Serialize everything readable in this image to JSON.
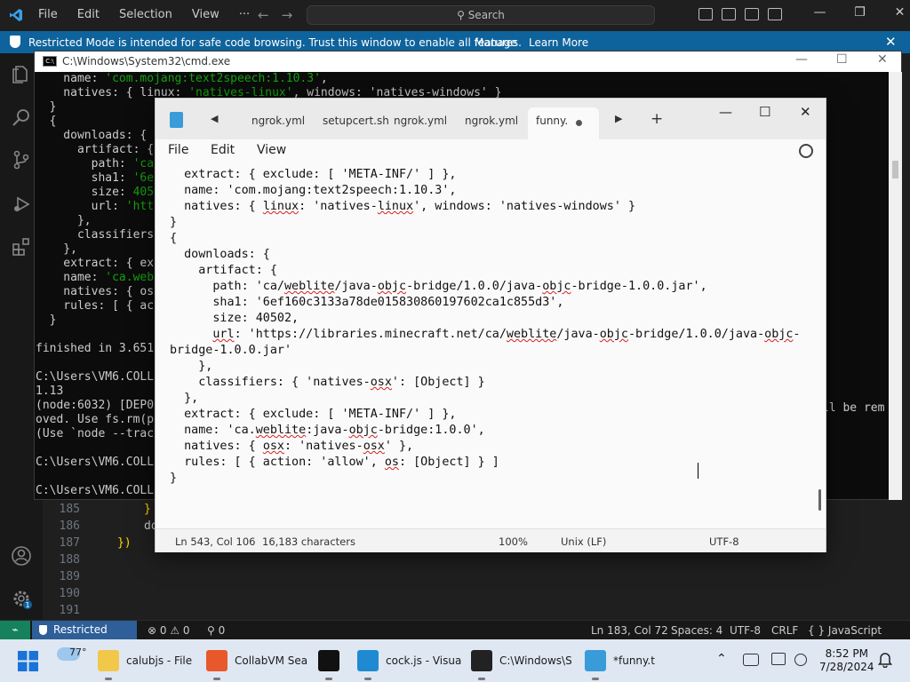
{
  "vscode": {
    "menu": [
      "File",
      "Edit",
      "Selection",
      "View",
      "···"
    ],
    "nav_back": "←",
    "nav_forward": "→",
    "search_label": "Search",
    "window_controls": [
      "—",
      "❐",
      "✕"
    ],
    "banner": {
      "message": "Restricted Mode is intended for safe code browsing. Trust this window to enable all features.",
      "manage_label": "Manage",
      "learn_more_label": "Learn More",
      "close": "✕"
    },
    "editor_lines": [
      {
        "num": "185",
        "code": "}"
      },
      {
        "num": "186",
        "code": "do"
      },
      {
        "num": "187",
        "code": "})"
      },
      {
        "num": "188",
        "code": ""
      },
      {
        "num": "189",
        "code": ""
      },
      {
        "num": "190",
        "code": ""
      },
      {
        "num": "191",
        "code": ""
      }
    ],
    "behind_text_right_1": "ll be rem",
    "behind_text_right_2": "",
    "status": {
      "remote_icon": "⌁",
      "restricted": "Restricted Mode",
      "errors": "⊗ 0 ⚠ 0",
      "ports": "⚲ 0",
      "position": "Ln 183, Col 72",
      "spaces": "Spaces: 4",
      "encoding": "UTF-8",
      "eol": "CRLF",
      "language": "{ } JavaScript",
      "accent": "#0e639c"
    }
  },
  "cmd": {
    "title": "C:\\Windows\\System32\\cmd.exe",
    "icon_text": "C:\\",
    "window_controls": [
      "—",
      "☐",
      "✕"
    ],
    "lines": [
      {
        "t": "    name: ",
        "g": "'com.mojang:text2speech:1.10.3'",
        "e": ","
      },
      {
        "t": "    natives: { linux: ",
        "g": "'natives-linux'",
        "e": ", windows: 'natives-windows' }"
      },
      {
        "t": "  }",
        "g": "",
        "e": ""
      },
      {
        "t": "  {",
        "g": "",
        "e": ""
      },
      {
        "t": "    downloads: {",
        "g": "",
        "e": ""
      },
      {
        "t": "      artifact: {",
        "g": "",
        "e": ""
      },
      {
        "t": "        path: ",
        "g": "'ca/w",
        "e": ""
      },
      {
        "t": "        sha1: ",
        "g": "'6ef1",
        "e": ""
      },
      {
        "t": "        size: ",
        "g": "40502",
        "e": ""
      },
      {
        "t": "        url: ",
        "g": "'https",
        "e": ""
      },
      {
        "t": "      },",
        "g": "",
        "e": ""
      },
      {
        "t": "      classifiers: ",
        "g": "",
        "e": ""
      },
      {
        "t": "    },",
        "g": "",
        "e": ""
      },
      {
        "t": "    extract: { excl",
        "g": "",
        "e": ""
      },
      {
        "t": "    name: ",
        "g": "'ca.webli",
        "e": ""
      },
      {
        "t": "    natives: { osx:",
        "g": "",
        "e": ""
      },
      {
        "t": "    rules: [ { acti",
        "g": "",
        "e": ""
      },
      {
        "t": "  }",
        "g": "",
        "e": ""
      },
      {
        "t": "",
        "g": "",
        "e": ""
      },
      {
        "t": "finished in 3.651",
        "g": "",
        "e": ""
      },
      {
        "t": "",
        "g": "",
        "e": ""
      },
      {
        "t": "C:\\Users\\VM6.COLL",
        "g": "",
        "e": ""
      },
      {
        "t": "1.13",
        "g": "",
        "e": ""
      },
      {
        "t": "(node:6032) [DEP0",
        "g": "",
        "e": ""
      },
      {
        "t": "oved. Use fs.rm(p",
        "g": "",
        "e": ""
      },
      {
        "t": "(Use `node --trac",
        "g": "",
        "e": ""
      },
      {
        "t": "",
        "g": "",
        "e": ""
      },
      {
        "t": "C:\\Users\\VM6.COLL",
        "g": "",
        "e": ""
      },
      {
        "t": "",
        "g": "",
        "e": ""
      },
      {
        "t": "C:\\Users\\VM6.COLL",
        "g": "",
        "e": ""
      }
    ]
  },
  "notepad": {
    "tabs": [
      "ngrok.yml",
      "setupcert.sh",
      "ngrok.yml",
      "ngrok.yml"
    ],
    "active_tab": "funny.",
    "nav_left": "◀",
    "nav_right": "▶",
    "new_tab": "+",
    "window_controls": [
      "—",
      "☐",
      "✕"
    ],
    "menu": [
      "File",
      "Edit",
      "View"
    ],
    "lines": [
      "  extract: { exclude: [ 'META-INF/' ] },",
      "  name: 'com.mojang:text2speech:1.10.3',",
      "  natives: { linux: 'natives-linux', windows: 'natives-windows' }",
      "}",
      "{",
      "  downloads: {",
      "    artifact: {",
      "      path: 'ca/weblite/java-objc-bridge/1.0.0/java-objc-bridge-1.0.0.jar',",
      "      sha1: '6ef160c3133a78de015830860197602ca1c855d3',",
      "      size: 40502,",
      "      url: 'https://libraries.minecraft.net/ca/weblite/java-objc-bridge/1.0.0/java-objc-",
      "bridge-1.0.0.jar'",
      "    },",
      "    classifiers: { 'natives-osx': [Object] }",
      "  },",
      "  extract: { exclude: [ 'META-INF/' ] },",
      "  name: 'ca.weblite:java-objc-bridge:1.0.0',",
      "  natives: { osx: 'natives-osx' },",
      "  rules: [ { action: 'allow', os: [Object] } ]",
      "}"
    ],
    "status": {
      "position": "Ln 543, Col 106",
      "characters": "16,183 characters",
      "zoom": "100%",
      "line_ending": "Unix (LF)",
      "encoding": "UTF-8"
    }
  },
  "taskbar": {
    "weather": "77°",
    "items": [
      {
        "label": "calubjs - File",
        "icon": "folder-icon",
        "color": "#f2c84b"
      },
      {
        "label": "CollabVM Sea",
        "icon": "firefox-icon",
        "color": "#e8582b"
      },
      {
        "label": "",
        "icon": "zed-icon",
        "color": "#111111"
      },
      {
        "label": "cock.js - Visua",
        "icon": "vscode-icon",
        "color": "#1f8ad2"
      },
      {
        "label": "C:\\Windows\\S",
        "icon": "cmd-icon",
        "color": "#222222"
      },
      {
        "label": "*funny.t",
        "icon": "notepad-icon",
        "color": "#3a9bd9"
      }
    ],
    "time": "8:52 PM",
    "date": "7/28/2024"
  }
}
